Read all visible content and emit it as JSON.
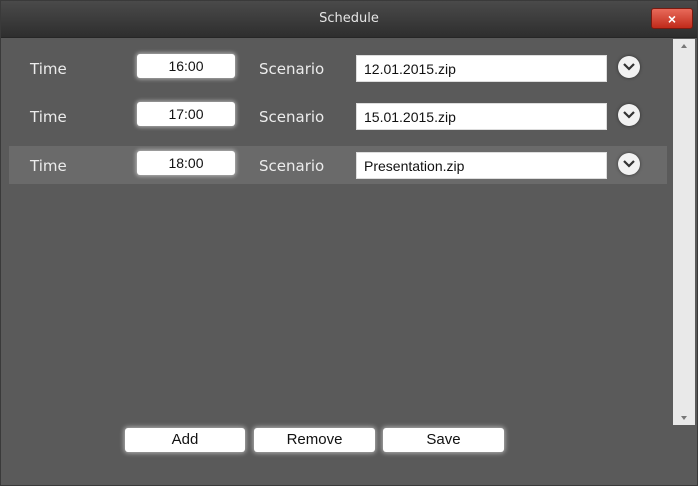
{
  "window": {
    "title": "Schedule",
    "close_label": "×"
  },
  "rows": [
    {
      "time_label": "Time",
      "time": "16:00",
      "scenario_label": "Scenario",
      "scenario": "12.01.2015.zip",
      "selected": false
    },
    {
      "time_label": "Time",
      "time": "17:00",
      "scenario_label": "Scenario",
      "scenario": "15.01.2015.zip",
      "selected": false
    },
    {
      "time_label": "Time",
      "time": "18:00",
      "scenario_label": "Scenario",
      "scenario": "Presentation.zip",
      "selected": true
    }
  ],
  "buttons": {
    "add": "Add",
    "remove": "Remove",
    "save": "Save"
  },
  "colors": {
    "background": "#5a5a5a",
    "selected_row": "#6a6a6a",
    "close": "#d2402e"
  },
  "icons": {
    "dropdown": "chevron-down-icon",
    "close": "close-icon",
    "scroll_up": "arrow-up-icon",
    "scroll_down": "arrow-down-icon"
  }
}
